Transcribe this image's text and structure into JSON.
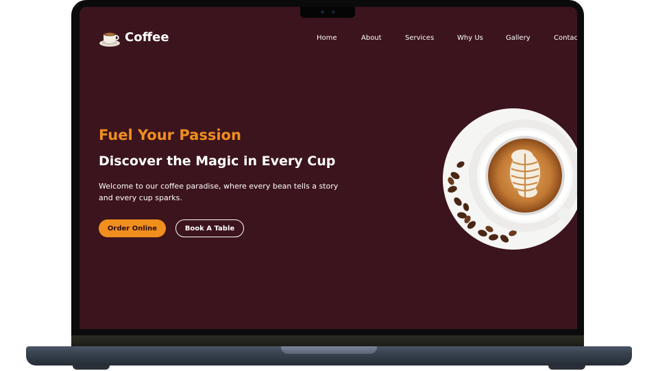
{
  "brand": {
    "name": "Coffee",
    "logo_icon": "coffee-cup-icon"
  },
  "nav": {
    "items": [
      "Home",
      "About",
      "Services",
      "Why Us",
      "Gallery",
      "Contact"
    ]
  },
  "hero": {
    "tagline": "Fuel Your Passion",
    "headline": "Discover the Magic in Every Cup",
    "description": "Welcome to our coffee paradise, where every bean tells a story and every cup sparks.",
    "primary_button": "Order Online",
    "secondary_button": "Book A Table",
    "image_icon": "latte-art-coffee-cup-icon"
  },
  "colors": {
    "background": "#3c141d",
    "accent": "#f08f1d",
    "text": "#ffffff"
  }
}
